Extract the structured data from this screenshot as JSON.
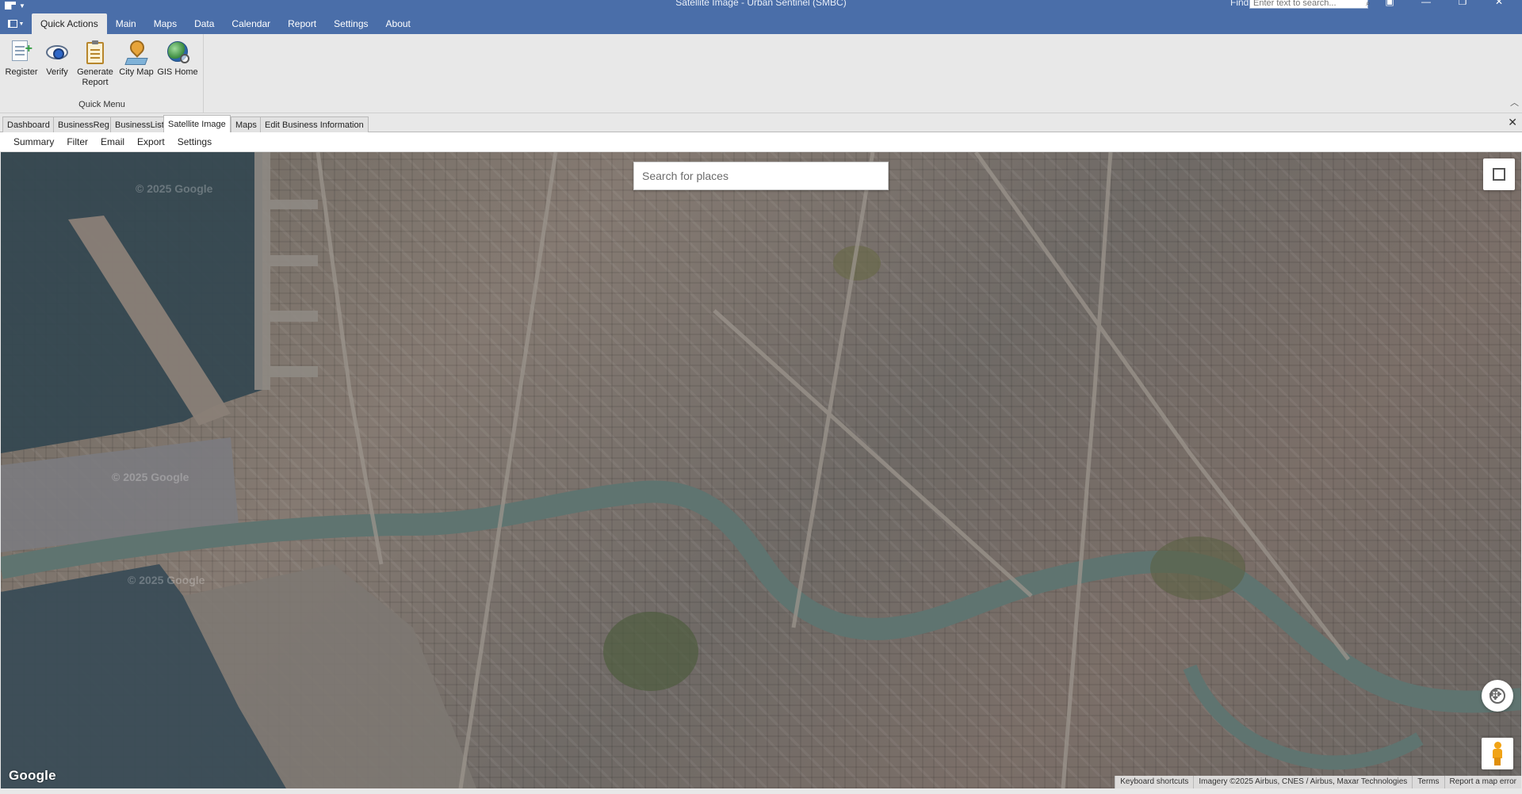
{
  "window": {
    "title": "Satellite Image - Urban Sentinel (SMBC)",
    "find_label": "Find",
    "find_placeholder": "Enter text to search...",
    "controls": [
      "▣",
      "—",
      "❐",
      "✕"
    ]
  },
  "ribbon": {
    "tabs": [
      "Quick Actions",
      "Main",
      "Maps",
      "Data",
      "Calendar",
      "Report",
      "Settings",
      "About"
    ],
    "active_tab": "Quick Actions",
    "group": {
      "label": "Quick Menu",
      "buttons": [
        {
          "label": "Register",
          "icon": "register-icon"
        },
        {
          "label": "Verify",
          "icon": "eye-icon"
        },
        {
          "label": "Generate Report",
          "icon": "clipboard-icon"
        },
        {
          "label": "City Map",
          "icon": "map-pin-icon"
        },
        {
          "label": "GIS Home",
          "icon": "globe-icon"
        }
      ]
    }
  },
  "doc_tabs": {
    "items": [
      "Dashboard",
      "BusinessReg",
      "BusinessList",
      "Satellite Image",
      "Maps",
      "Edit Business Information"
    ],
    "active": "Satellite Image",
    "close": "✕"
  },
  "toolbar": {
    "items": [
      "Summary",
      "Filter",
      "Email",
      "Export",
      "Settings"
    ]
  },
  "map": {
    "search_placeholder": "Search for places",
    "logo": "Google",
    "watermarks": [
      "© 2025 Google",
      "© 2025 Google",
      "© 2025 Google"
    ],
    "footer": [
      "Keyboard shortcuts",
      "Imagery ©2025 Airbus, CNES / Airbus, Maxar Technologies",
      "Terms",
      "Report a map error"
    ],
    "colors": {
      "water": "#3d4f58",
      "river": "#5f7470",
      "urban": "#7a716b"
    }
  }
}
